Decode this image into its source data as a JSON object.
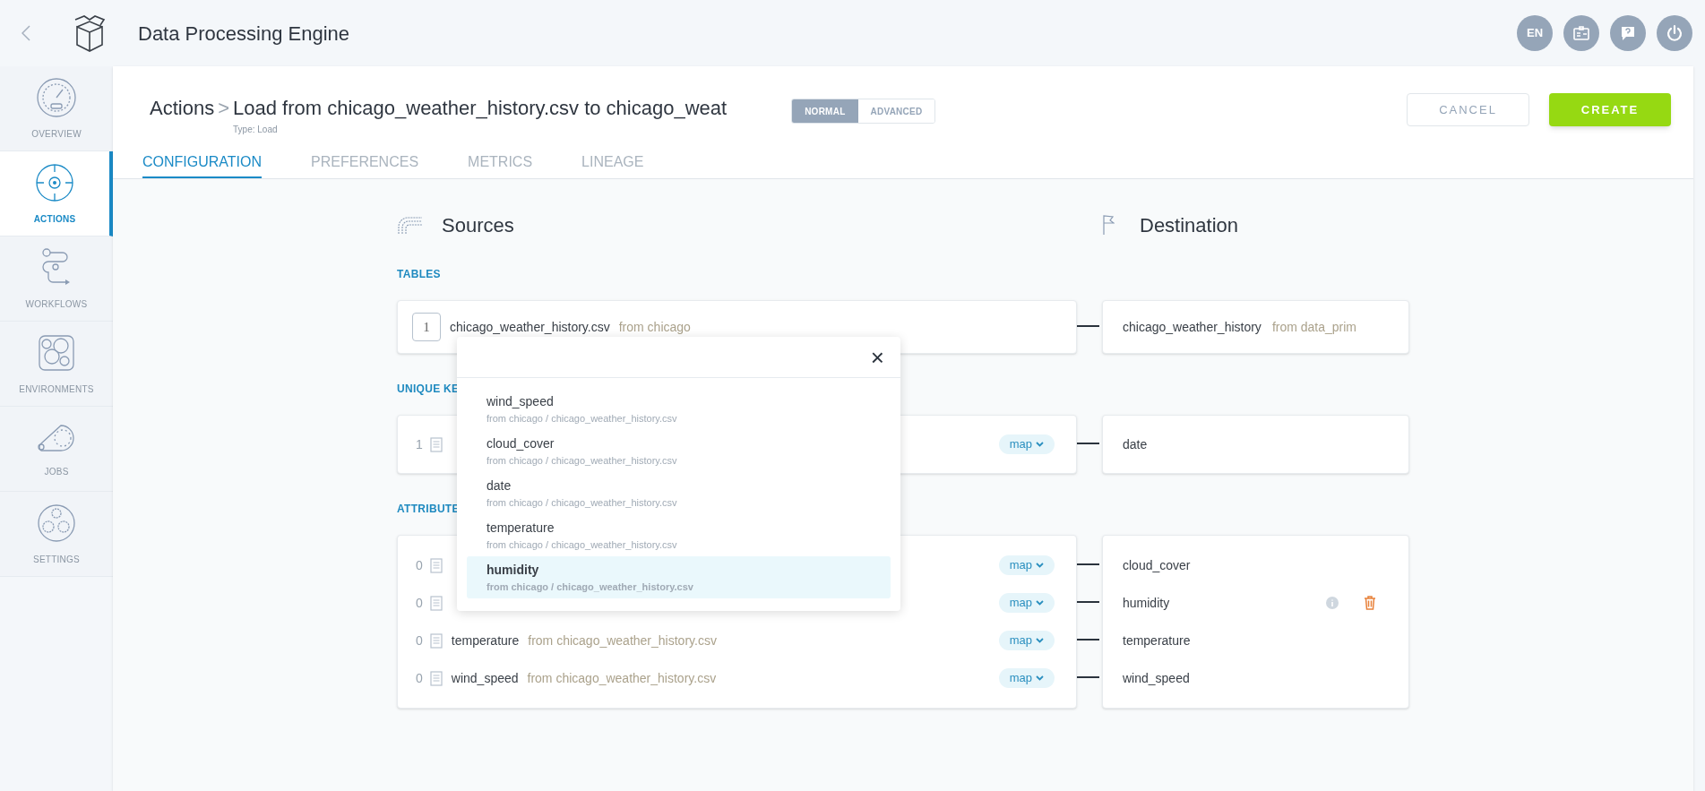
{
  "header": {
    "title": "Data Processing Engine",
    "buttons": [
      {
        "kind": "text",
        "label": "EN"
      },
      {
        "kind": "badge"
      },
      {
        "kind": "help"
      },
      {
        "kind": "power"
      }
    ]
  },
  "sidebar": {
    "items": [
      {
        "label": "OVERVIEW",
        "kind": "gauge",
        "selected": false
      },
      {
        "label": "ACTIONS",
        "kind": "target",
        "selected": true
      },
      {
        "label": "WORKFLOWS",
        "kind": "flow",
        "selected": false
      },
      {
        "label": "ENVIRONMENTS",
        "kind": "cells",
        "selected": false
      },
      {
        "label": "JOBS",
        "kind": "belt",
        "selected": false
      },
      {
        "label": "SETTINGS",
        "kind": "gears",
        "selected": false
      }
    ]
  },
  "breadcrumb": {
    "parent": "Actions",
    "separator": ">",
    "title": "Load from chicago_weather_history.csv to chicago_weat",
    "type_label": "Type:",
    "type_value": "Load"
  },
  "modes": [
    {
      "label": "NORMAL",
      "selected": true
    },
    {
      "label": "ADVANCED",
      "selected": false
    }
  ],
  "buttons": {
    "cancel": "CANCEL",
    "create": "CREATE"
  },
  "tabs": [
    {
      "label": "CONFIGURATION",
      "selected": true
    },
    {
      "label": "PREFERENCES",
      "selected": false
    },
    {
      "label": "METRICS",
      "selected": false
    },
    {
      "label": "LINEAGE",
      "selected": false
    }
  ],
  "sources_title": "Sources",
  "destination_title": "Destination",
  "sections": [
    {
      "label": "TABLES",
      "kind": "table",
      "rows": [
        {
          "index": "1",
          "name": "chicago_weather_history.csv",
          "origin": "from chicago",
          "dest_name": "chicago_weather_history",
          "dest_origin": "from data_prim",
          "actions_shown": false
        }
      ]
    },
    {
      "label": "UNIQUE KE",
      "kind": "field",
      "rows": [
        {
          "index": "1",
          "map": "map",
          "dest_name": "date",
          "actions_shown": false
        }
      ]
    },
    {
      "label": "ATTRIBUTE",
      "kind": "field",
      "rows": [
        {
          "index": "0",
          "map": "map",
          "dest_name": "cloud_cover",
          "actions_shown": false
        },
        {
          "index": "0",
          "map": "map",
          "dest_name": "humidity",
          "actions_shown": true
        },
        {
          "index": "0",
          "name": "temperature",
          "origin": "from chicago_weather_history.csv",
          "map": "map",
          "dest_name": "temperature",
          "actions_shown": false
        },
        {
          "index": "0",
          "name": "wind_speed",
          "origin": "from chicago_weather_history.csv",
          "map": "map",
          "dest_name": "wind_speed",
          "actions_shown": false
        }
      ]
    }
  ],
  "popup": {
    "close": "×",
    "items": [
      {
        "name": "wind_speed",
        "origin": "from chicago / chicago_weather_history.csv",
        "selected": false
      },
      {
        "name": "cloud_cover",
        "origin": "from chicago / chicago_weather_history.csv",
        "selected": false
      },
      {
        "name": "date",
        "origin": "from chicago / chicago_weather_history.csv",
        "selected": false
      },
      {
        "name": "temperature",
        "origin": "from chicago / chicago_weather_history.csv",
        "selected": false
      },
      {
        "name": "humidity",
        "origin": "from chicago / chicago_weather_history.csv",
        "selected": true
      }
    ]
  }
}
